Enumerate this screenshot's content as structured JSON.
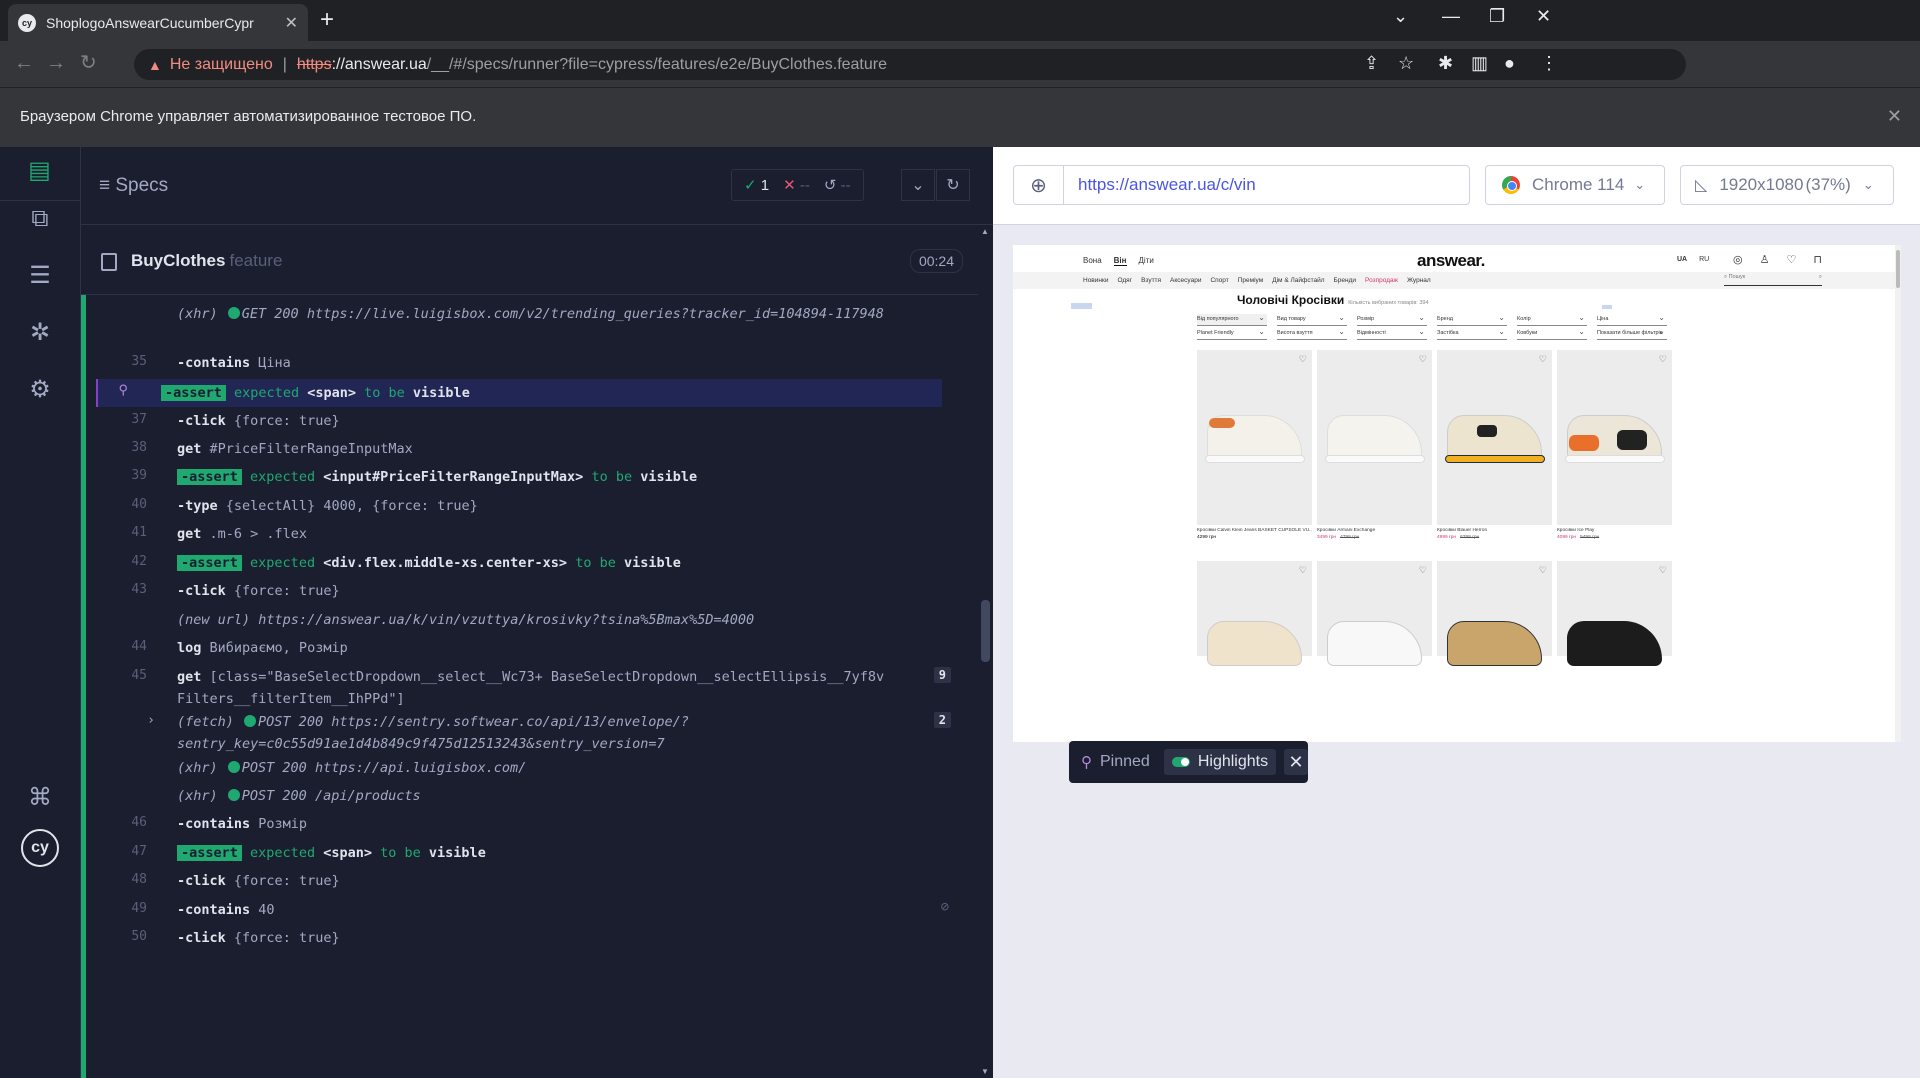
{
  "browser": {
    "tab_title": "ShoplogoAnswearCucumberCypr",
    "tab_favicon": "cy",
    "security_label": "Не защищено",
    "url_scheme": "https",
    "url_host": "://answear.ua",
    "url_rest": "/__/#/specs/runner?file=cypress/features/e2e/BuyClothes.feature",
    "infobar_text": "Браузером Chrome управляет автоматизированное тестовое ПО."
  },
  "reporter": {
    "specs_label": "Specs",
    "passed": "1",
    "failed": "--",
    "pending": "--",
    "spec_name": "BuyClothes",
    "spec_ext": "feature",
    "duration": "00:24"
  },
  "commands": [
    {
      "num": "",
      "type": "xhr",
      "text": "(xhr)",
      "method": "GET 200",
      "url": "https://live.luigisbox.com/v2/trending_queries?tracker_id=104894-117948"
    },
    {
      "num": "35",
      "name": "-contains",
      "arg": "Ціна"
    },
    {
      "num": "",
      "name": "-assert",
      "pre": "expected",
      "el": "<span>",
      "mid": "to be",
      "state": "visible"
    },
    {
      "num": "37",
      "name": "-click",
      "arg": "{force: true}"
    },
    {
      "num": "38",
      "name": "get",
      "arg": "#PriceFilterRangeInputMax"
    },
    {
      "num": "39",
      "name": "-assert",
      "pre": "expected",
      "el": "<input#PriceFilterRangeInputMax>",
      "mid": "to be",
      "state": "visible"
    },
    {
      "num": "40",
      "name": "-type",
      "arg": "{selectAll} 4000, {force: true}"
    },
    {
      "num": "41",
      "name": "get",
      "arg": ".m-6 > .flex"
    },
    {
      "num": "42",
      "name": "-assert",
      "pre": "expected",
      "el": "<div.flex.middle-xs.center-xs>",
      "mid": "to be",
      "state": "visible"
    },
    {
      "num": "43",
      "name": "-click",
      "arg": "{force: true}"
    },
    {
      "num": "",
      "name": "(new url)",
      "arg": "https://answear.ua/k/vin/vzuttya/krosivky?tsina%5Bmax%5D=4000"
    },
    {
      "num": "44",
      "name": "log",
      "arg": "Вибираємо, Розмір"
    },
    {
      "num": "45",
      "name": "get",
      "arg": "[class=\"BaseSelectDropdown__select__Wc73+ BaseSelectDropdown__selectEllipsis__7yf8v Filters__filterItem__IhPPd\"]",
      "badge": "9"
    },
    {
      "num": "",
      "type": "fetch",
      "text": "(fetch)",
      "method": "POST 200",
      "url": "https://sentry.softwear.co/api/13/envelope/?sentry_key=c0c55d91ae1d4b849c9f475d12513243&sentry_version=7",
      "badge": "2"
    },
    {
      "num": "",
      "type": "xhr",
      "text": "(xhr)",
      "method": "POST 200",
      "url": "https://api.luigisbox.com/"
    },
    {
      "num": "",
      "type": "xhr",
      "text": "(xhr)",
      "method": "POST 200",
      "url": "/api/products"
    },
    {
      "num": "46",
      "name": "-contains",
      "arg": "Розмір"
    },
    {
      "num": "47",
      "name": "-assert",
      "pre": "expected",
      "el": "<span>",
      "mid": "to be",
      "state": "visible"
    },
    {
      "num": "48",
      "name": "-click",
      "arg": "{force: true}"
    },
    {
      "num": "49",
      "name": "-contains",
      "arg": "40"
    },
    {
      "num": "50",
      "name": "-click",
      "arg": "{force: true}"
    }
  ],
  "aut": {
    "url": "https://answear.ua/c/vin",
    "browser": "Chrome 114",
    "viewport": "1920x1080",
    "scale": "(37%)"
  },
  "site": {
    "nav": [
      "Вона",
      "Він",
      "Діти"
    ],
    "logo": "answear.",
    "langs": [
      "UA",
      "RU"
    ],
    "menu": [
      "Новинки",
      "Одяг",
      "Взуття",
      "Аксесуари",
      "Спорт",
      "Преміум",
      "Дім & Лайфстайл",
      "Бренди",
      "Розпродаж",
      "Журнал"
    ],
    "search": "Пошук",
    "title": "Чоловічі Кросівки",
    "count": "Кількість вибраних товарів: 394",
    "filters_row1": [
      "Від популярного",
      "Вид товару",
      "Розмір",
      "Бренд",
      "Колір",
      "Ціна"
    ],
    "filters_row2": [
      "Planet Friendly",
      "Висота взуття",
      "Відмінності",
      "Застібка",
      "Ковбуки",
      "Показати більше фільтрів"
    ],
    "products": [
      {
        "name": "Кросівки Calvin Klein Jeans BASKET CUPSOLE VU...",
        "price": "4299 грн",
        "old": ""
      },
      {
        "name": "Кросівки Armani Exchange",
        "price": "3499 грн",
        "old": "4799 грн"
      },
      {
        "name": "Кросівки Blauer Herron",
        "price": "4999 грн",
        "old": "6299 грн"
      },
      {
        "name": "Кросівки Ice Play",
        "price": "4099 грн",
        "old": "5499 грн"
      }
    ]
  },
  "pinbar": {
    "pinned": "Pinned",
    "highlights": "Highlights"
  }
}
